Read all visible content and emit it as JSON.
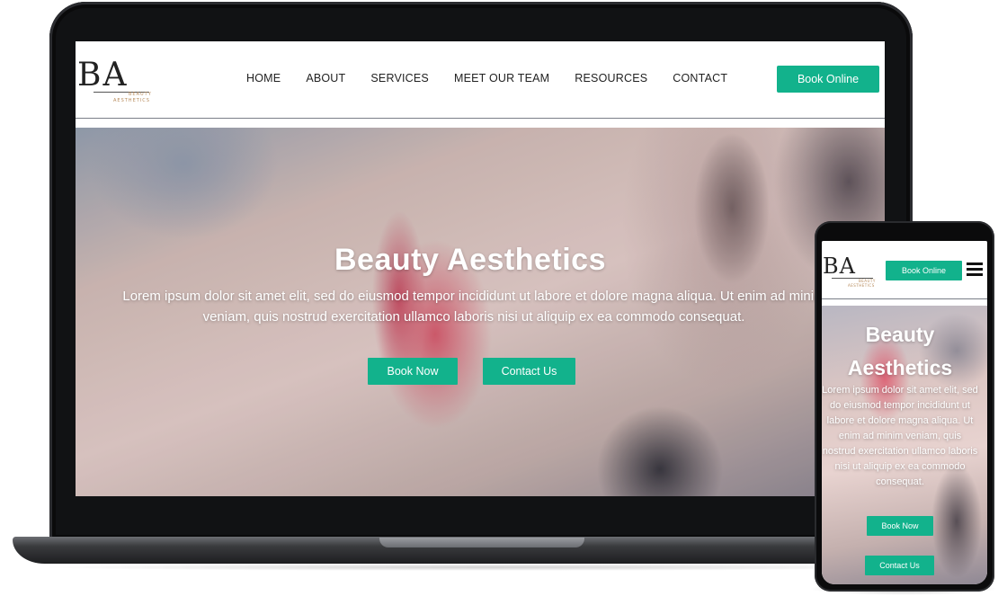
{
  "brand": {
    "logo_mark": "BA",
    "logo_sub_1": "BEAUTY",
    "logo_sub_2": "AESTHETICS"
  },
  "nav": {
    "items": [
      {
        "label": "HOME"
      },
      {
        "label": "ABOUT"
      },
      {
        "label": "SERVICES"
      },
      {
        "label": "MEET OUR TEAM"
      },
      {
        "label": "RESOURCES"
      },
      {
        "label": "CONTACT"
      }
    ],
    "book_online_label": "Book Online"
  },
  "hero": {
    "title": "Beauty Aesthetics",
    "text": "Lorem ipsum dolor sit amet elit, sed do eiusmod tempor incididunt ut labore et dolore magna aliqua. Ut enim ad minim veniam, quis nostrud exercitation ullamco laboris nisi ut aliquip ex ea commodo consequat.",
    "book_now_label": "Book Now",
    "contact_us_label": "Contact Us"
  },
  "mobile": {
    "book_online_label": "Book Online",
    "menu_icon": "hamburger-menu-icon",
    "hero_title": "Beauty Aesthetics",
    "hero_text": "Lorem ipsum dolor sit amet elit, sed do eiusmod tempor incididunt ut labore et dolore magna aliqua. Ut enim ad minim veniam, quis nostrud exercitation ullamco laboris nisi ut aliquip ex ea commodo consequat.",
    "book_now_label": "Book Now",
    "contact_us_label": "Contact Us"
  },
  "colors": {
    "accent": "#12b28c",
    "logo_gold": "#b78a5a",
    "device_frame": "#111214"
  }
}
